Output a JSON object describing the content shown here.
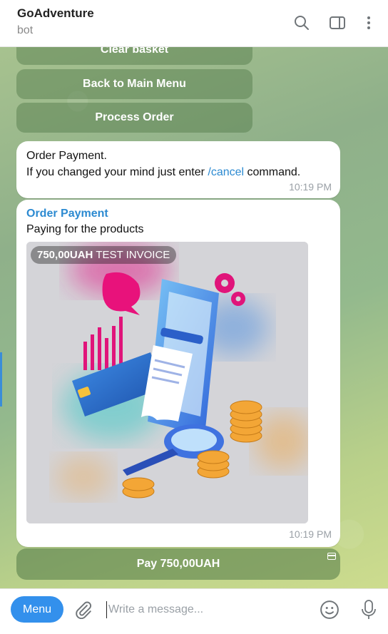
{
  "header": {
    "title": "GoAdventure",
    "subtitle": "bot",
    "icons": [
      "search-icon",
      "sidebar-toggle-icon",
      "more-vertical-icon"
    ]
  },
  "keyboard_buttons": {
    "clear_basket": "Clear basket",
    "back_main": "Back to Main Menu",
    "process_order": "Process Order"
  },
  "message1": {
    "line1": "Order Payment.",
    "line2_prefix": "If you changed your mind just enter ",
    "command": "/cancel",
    "line2_suffix": " command.",
    "time": "10:19 PM"
  },
  "invoice": {
    "title": "Order Payment",
    "description": "Paying for the products",
    "amount": "750,00UAH",
    "badge_label": "TEST INVOICE",
    "time": "10:19 PM",
    "pay_button": "Pay 750,00UAH"
  },
  "composer": {
    "menu_label": "Menu",
    "placeholder": "Write a message..."
  },
  "colors": {
    "accent": "#3390ec",
    "link": "#2c8ad1"
  }
}
